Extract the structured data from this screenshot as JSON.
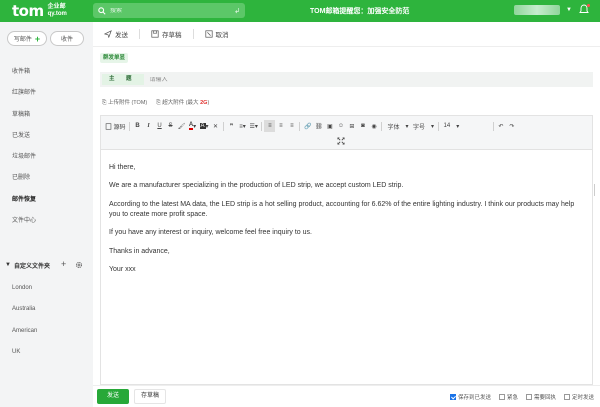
{
  "topbar": {
    "logo_main": "tom",
    "logo_sub_top": "企业邮",
    "logo_sub_bottom": "qy.tom",
    "search_placeholder": "搜索",
    "notice": "TOM邮箱提醒您：加强安全防范",
    "accent_color": "#2eb43d"
  },
  "sidebar": {
    "compose_label": "写邮件",
    "receive_label": "收件",
    "nav": [
      {
        "label": "收件箱"
      },
      {
        "label": "红旗邮件"
      },
      {
        "label": "草稿箱"
      },
      {
        "label": "已发送"
      },
      {
        "label": "垃圾邮件"
      },
      {
        "label": "已删除"
      },
      {
        "label": "邮件恢复"
      },
      {
        "label": "文件中心"
      }
    ],
    "folder_title": "自定义文件夹",
    "folders": [
      {
        "label": "London"
      },
      {
        "label": "Australia"
      },
      {
        "label": "American"
      },
      {
        "label": "UK"
      }
    ]
  },
  "toolbar": {
    "send": "发送",
    "save_draft": "存草稿",
    "cancel": "取消"
  },
  "compose": {
    "group_send": "群发单显",
    "theme_label": "主 题",
    "theme_placeholder": "请输入",
    "attach_label": "上传附件 (TOM)",
    "big_attach_label": "超大附件 (最大",
    "big_attach_size": "2G",
    "big_attach_close": ")"
  },
  "format_bar": {
    "source": "源码",
    "font_family": "字体",
    "font_size": "字号",
    "text_size": "14"
  },
  "body": {
    "greeting": "Hi there,",
    "p1": "We are a manufacturer specializing in the production of LED strip, we accept custom LED strip.",
    "p2": "According to the latest MA data, the LED strip is a hot selling product, accounting for 6.62% of the entire lighting industry. I think our products may help you to create more profit space.",
    "p3": "If you have any interest or inquiry, welcome feel free inquiry to us.",
    "p4": "Thanks in advance,",
    "sign": "Your xxx"
  },
  "bottom": {
    "send": "发送",
    "draft": "存草稿",
    "options": [
      {
        "label": "保存到已发送",
        "checked": true
      },
      {
        "label": "紧急",
        "checked": false
      },
      {
        "label": "需要回执",
        "checked": false
      },
      {
        "label": "定时发送",
        "checked": false
      }
    ]
  }
}
